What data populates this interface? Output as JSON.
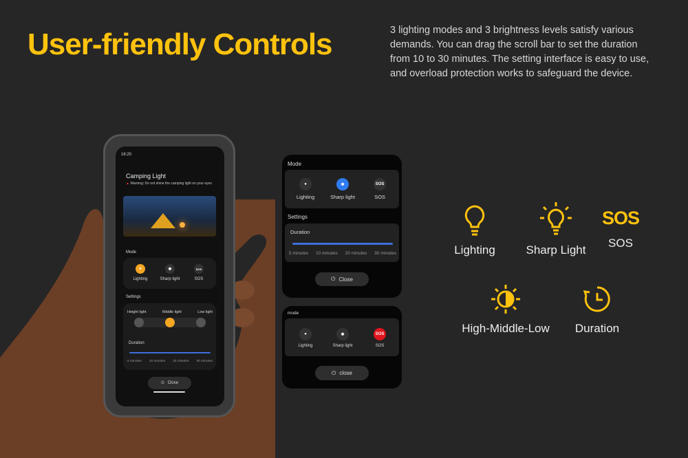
{
  "headline": "User-friendly Controls",
  "description": "3 lighting modes and 3 brightness levels satisfy various demands. You can drag the scroll bar to set the duration from 10 to 30 minutes. The setting interface is easy to use, and overload protection works to safeguard the device.",
  "accent_color": "#FFC20E",
  "phone": {
    "status_time": "16:20",
    "app_title": "Camping Light",
    "warning": "Warning: Do not shine the camping light on your eyes",
    "mode_label": "Mode",
    "modes": [
      {
        "label": "Lighting",
        "icon": "bulb-icon",
        "active": true
      },
      {
        "label": "Sharp light",
        "icon": "sharp-bulb-icon"
      },
      {
        "label": "SOS",
        "icon": "SOS"
      }
    ],
    "settings_label": "Settings",
    "brightness": [
      "Height light",
      "Middle light",
      "Low light"
    ],
    "brightness_selected": "Middle light",
    "duration_label": "Duration",
    "duration_ticks": [
      "5 minutes",
      "10 minutes",
      "20 minutes",
      "30 minutes"
    ],
    "duration_value_percent": 100,
    "close": "Close"
  },
  "panel1": {
    "mode_label": "Mode",
    "modes": [
      "Lighting",
      "Sharp light",
      "SOS"
    ],
    "active": "Sharp light",
    "active_color": "#2f7bf0",
    "settings_label": "Settings",
    "duration_label": "Duration",
    "duration_ticks": [
      "5 minutes",
      "10 minutes",
      "20 minutes",
      "30 minutes"
    ],
    "close": "Close"
  },
  "panel2": {
    "mode_label": "mode",
    "modes": [
      "Lighting",
      "Sharp light",
      "SOS"
    ],
    "active": "SOS",
    "active_color": "#e0141c",
    "close": "close",
    "sos_icon": "SOS"
  },
  "features": [
    {
      "label": "Lighting",
      "icon": "bulb-icon"
    },
    {
      "label": "Sharp Light",
      "icon": "sharp-bulb-icon"
    },
    {
      "label": "SOS",
      "icon": "SOS"
    },
    {
      "label": "High-Middle-Low",
      "icon": "brightness-icon"
    },
    {
      "label": "Duration",
      "icon": "timer-icon"
    }
  ]
}
